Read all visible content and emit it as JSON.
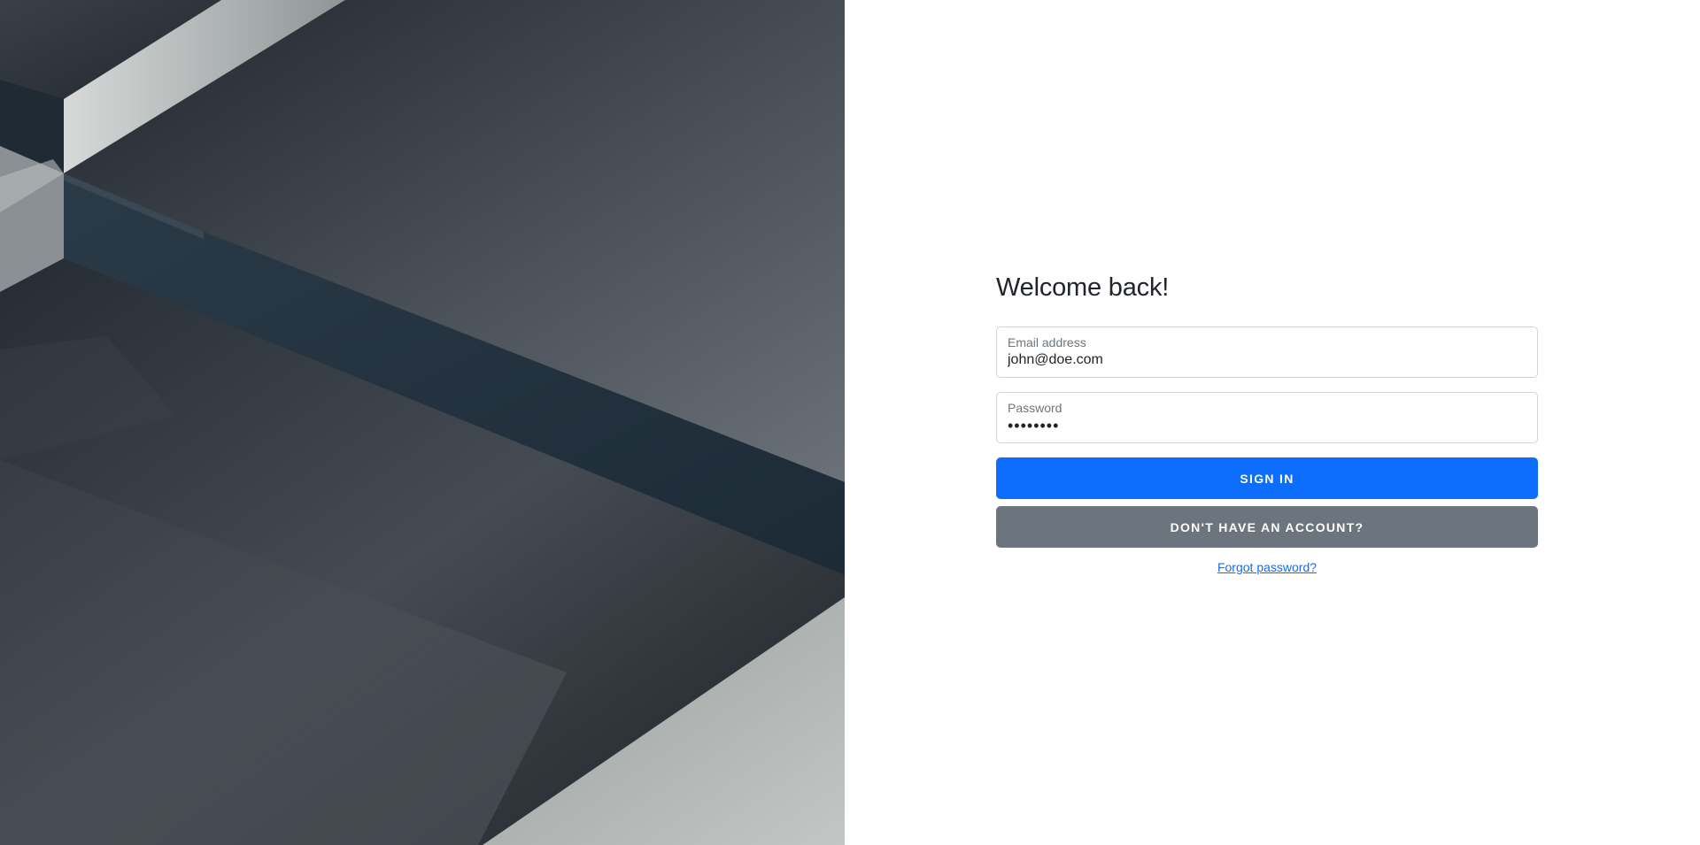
{
  "login": {
    "heading": "Welcome back!",
    "email": {
      "label": "Email address",
      "value": "john@doe.com"
    },
    "password": {
      "label": "Password",
      "value": "••••••••"
    },
    "sign_in_label": "Sign in",
    "register_label": "Don't have an account?",
    "forgot_label": "Forgot password?"
  },
  "colors": {
    "primary": "#0d6efd",
    "secondary": "#6c757d",
    "heading_text": "#212529",
    "field_border": "#ced4da",
    "hero_dark": "#1a1f25",
    "hero_light": "#b9bdbd"
  },
  "hero": {
    "content": "abstract-geometric-image"
  }
}
